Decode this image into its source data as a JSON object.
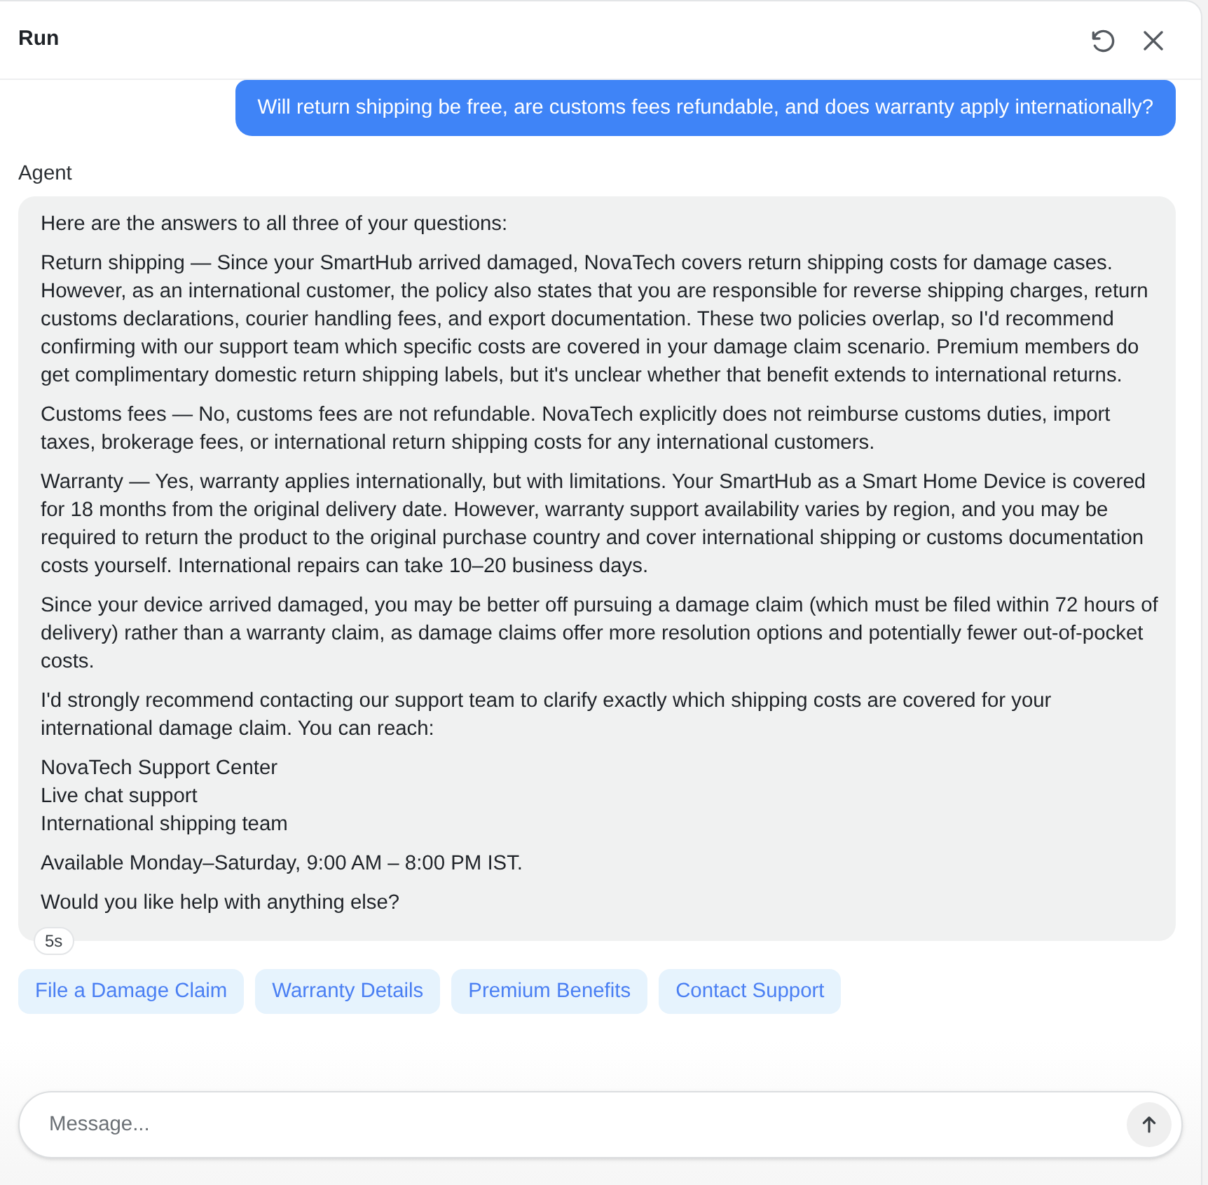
{
  "header": {
    "title": "Run"
  },
  "messages": [
    {
      "kind": "user",
      "text": "Will return shipping be free, are customs fees refundable, and does warranty apply internationally?"
    },
    {
      "kind": "agent",
      "label": "Agent",
      "duration": "5s",
      "paragraphs": [
        {
          "kind": "text",
          "text": "Here are the answers to all three of your questions:"
        },
        {
          "kind": "text",
          "text": "Return shipping — Since your SmartHub arrived damaged, NovaTech covers return shipping costs for damage cases. However, as an international customer, the policy also states that you are responsible for reverse shipping charges, return customs declarations, courier handling fees, and export documentation. These two policies overlap, so I'd recommend confirming with our support team which specific costs are covered in your damage claim scenario. Premium members do get complimentary domestic return shipping labels, but it's unclear whether that benefit extends to international returns."
        },
        {
          "kind": "text",
          "text": "Customs fees — No, customs fees are not refundable. NovaTech explicitly does not reimburse customs duties, import taxes, brokerage fees, or international return shipping costs for any international customers."
        },
        {
          "kind": "text",
          "text": "Warranty — Yes, warranty applies internationally, but with limitations. Your SmartHub as a Smart Home Device is covered for 18 months from the original delivery date. However, warranty support availability varies by region, and you may be required to return the product to the original purchase country and cover international shipping or customs documentation costs yourself. International repairs can take 10–20 business days."
        },
        {
          "kind": "text",
          "text": "Since your device arrived damaged, you may be better off pursuing a damage claim (which must be filed within 72 hours of delivery) rather than a warranty claim, as damage claims offer more resolution options and potentially fewer out-of-pocket costs."
        },
        {
          "kind": "text",
          "text": "I'd strongly recommend contacting our support team to clarify exactly which shipping costs are covered for your international damage claim. You can reach:"
        },
        {
          "kind": "lines",
          "lines": [
            "NovaTech Support Center",
            "Live chat support",
            "International shipping team"
          ]
        },
        {
          "kind": "text",
          "text": "Available Monday–Saturday, 9:00 AM – 8:00 PM IST."
        },
        {
          "kind": "text",
          "text": "Would you like help with anything else?"
        }
      ]
    }
  ],
  "suggestions": [
    "File a Damage Claim",
    "Warranty Details",
    "Premium Benefits",
    "Contact Support"
  ],
  "composer": {
    "placeholder": "Message..."
  }
}
